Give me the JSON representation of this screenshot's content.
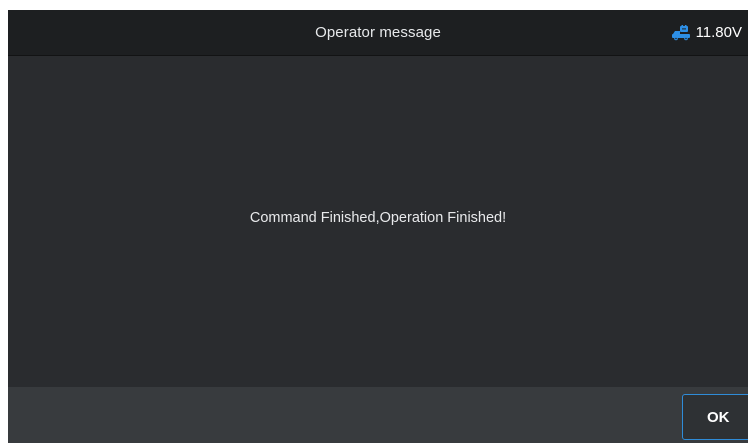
{
  "header": {
    "title": "Operator message",
    "voltage": "11.80V",
    "voltage_icon": "vehicle-battery-icon"
  },
  "content": {
    "message": "Command Finished,Operation Finished!"
  },
  "footer": {
    "ok_label": "OK"
  },
  "colors": {
    "header_bg": "#1d1f21",
    "content_bg": "#2a2c2f",
    "footer_bg": "#383b3e",
    "accent": "#2f8cd8",
    "icon_blue": "#2d8fe6"
  }
}
